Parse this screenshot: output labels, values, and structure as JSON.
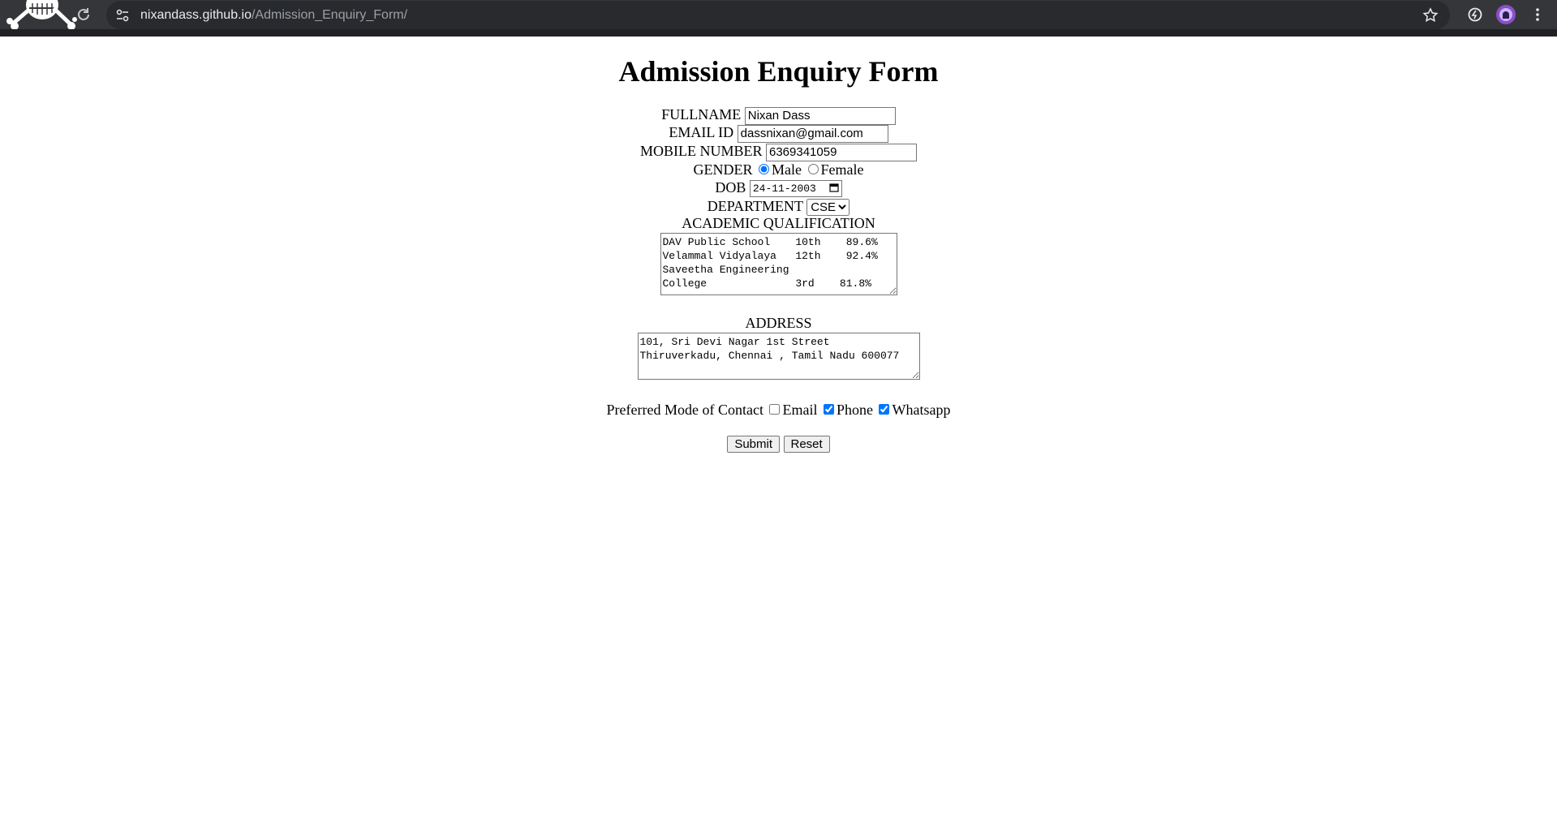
{
  "browser": {
    "url_host": "nixandass.github.io",
    "url_path": "/Admission_Enquiry_Form/"
  },
  "form": {
    "title": "Admission Enquiry Form",
    "fullname_label": "FULLNAME",
    "fullname_value": "Nixan Dass",
    "email_label": "EMAIL ID",
    "email_value": "dassnixan@gmail.com",
    "mobile_label": "MOBILE NUMBER",
    "mobile_value": "6369341059",
    "gender_label": "GENDER",
    "gender_options": [
      "Male",
      "Female"
    ],
    "gender_selected": "Male",
    "dob_label": "DOB",
    "dob_value": "24-11-2003",
    "department_label": "DEPARTMENT",
    "department_selected": "CSE",
    "academic_label": "ACADEMIC QUALIFICATION",
    "academic_value": "DAV Public School    10th    89.6%\nVelammal Vidyalaya   12th    92.4%\nSaveetha Engineering\nCollege              3rd    81.8%",
    "address_label": "ADDRESS",
    "address_value": "101, Sri Devi Nagar 1st Street\nThiruverkadu, Chennai , Tamil Nadu 600077",
    "contact_label": "Preferred Mode of Contact",
    "contact_options": [
      "Email",
      "Phone",
      "Whatsapp"
    ],
    "contact_checked": [
      false,
      true,
      true
    ],
    "submit_label": "Submit",
    "reset_label": "Reset"
  }
}
